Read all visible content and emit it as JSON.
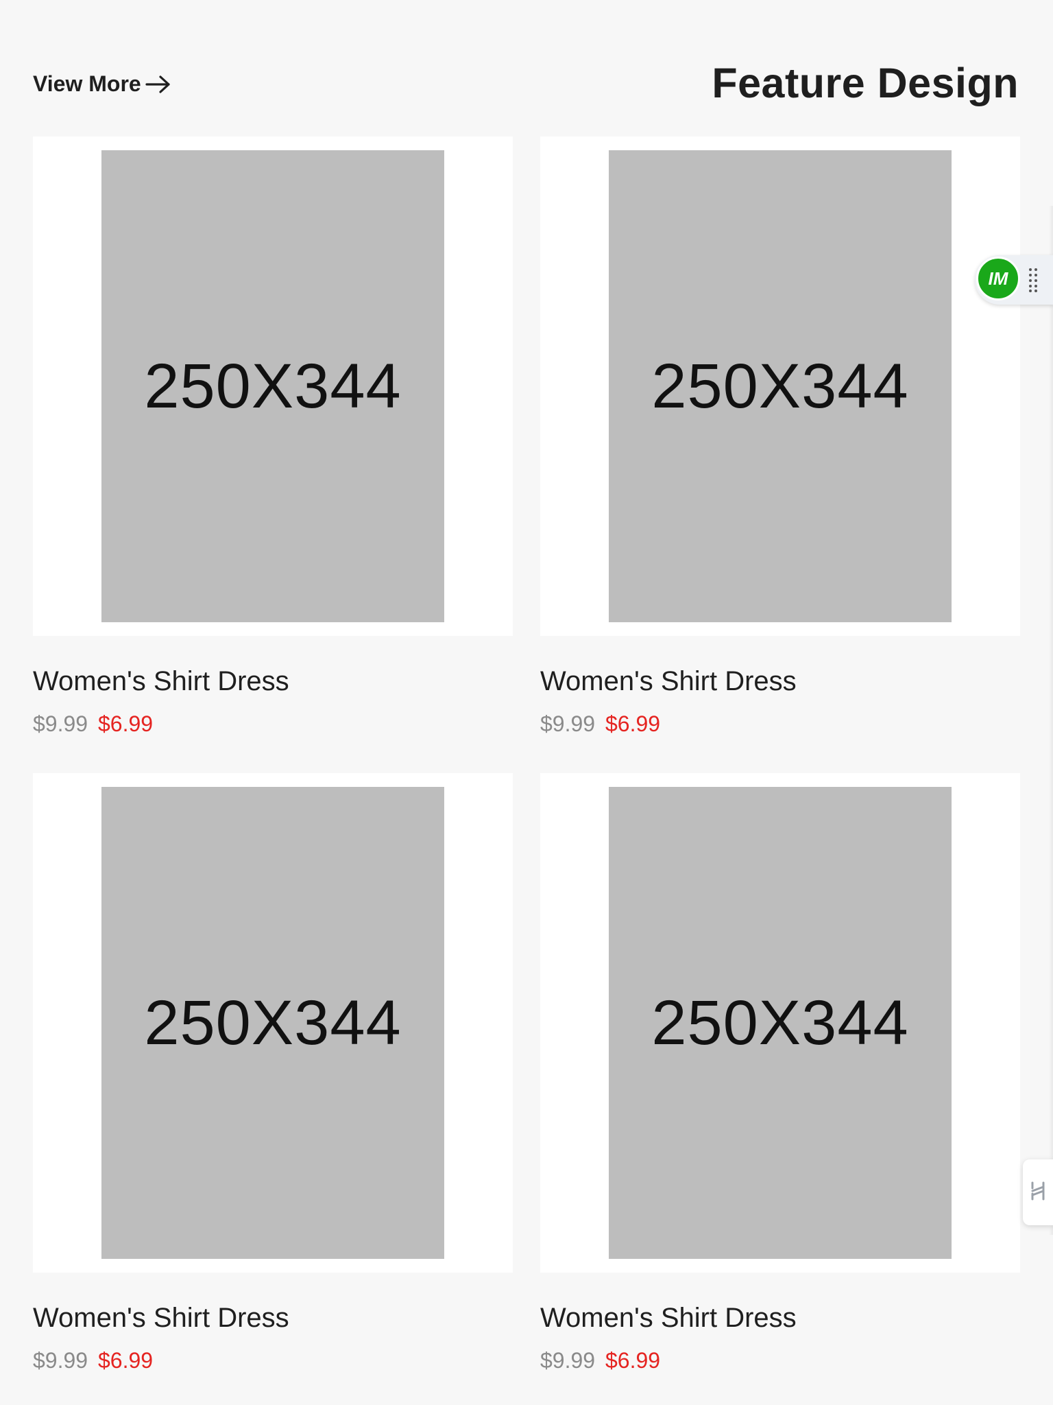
{
  "header": {
    "view_more_label": "View More",
    "title": "Feature Design"
  },
  "products": [
    {
      "image_text": "250X344",
      "name": "Women's Shirt Dress",
      "old_price": "$9.99",
      "new_price": "$6.99"
    },
    {
      "image_text": "250X344",
      "name": "Women's Shirt Dress",
      "old_price": "$9.99",
      "new_price": "$6.99"
    },
    {
      "image_text": "250X344",
      "name": "Women's Shirt Dress",
      "old_price": "$9.99",
      "new_price": "$6.99"
    },
    {
      "image_text": "250X344",
      "name": "Women's Shirt Dress",
      "old_price": "$9.99",
      "new_price": "$6.99"
    }
  ],
  "widgets": {
    "floating_logo_text": "IM"
  },
  "colors": {
    "background": "#f7f7f7",
    "placeholder": "#bdbdbd",
    "sale_price": "#e52421",
    "old_price": "#8a8a8a",
    "widget_green": "#1aa81a"
  },
  "icons": {
    "view_more": "arrow-right-icon",
    "drag": "drag-handle-icon",
    "side_tab": "chat-icon"
  }
}
